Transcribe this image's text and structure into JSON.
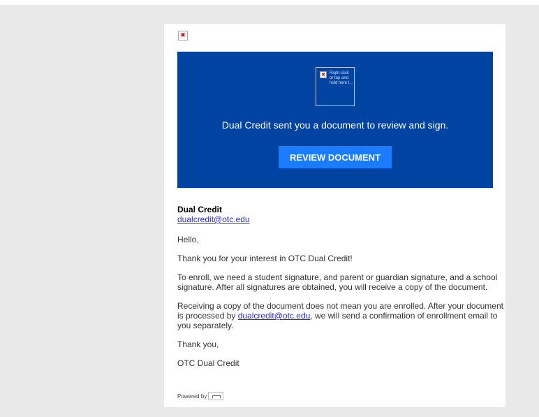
{
  "banner": {
    "broken_image_alt": "Right-click or tap and hold here t...",
    "message": "Dual Credit sent you a document to review and sign.",
    "button_label": "REVIEW DOCUMENT",
    "bg_color": "#0043a0",
    "button_color": "#1b7cff"
  },
  "sender": {
    "name": "Dual Credit",
    "email": "dualcredit@otc.edu"
  },
  "body": {
    "greeting": "Hello,",
    "para1": "Thank you for your interest in OTC Dual Credit!",
    "para2": "To enroll, we need a student signature, and parent or guardian signature, and a school signature. After all signatures are obtained, you will receive a copy of the document.",
    "para3_before": "Receiving a copy of the document does not mean you are enrolled. After your document is processed by ",
    "para3_link": "dualcredit@otc.edu",
    "para3_after": ", we will send a confirmation of enrollment email to you separately.",
    "closing": "Thank you,",
    "signature": "OTC Dual Credit"
  },
  "footer": {
    "powered_by": "Powered by"
  },
  "icons": {
    "broken_image": "broken-image-icon",
    "powered_logo": "docusign-logo-icon"
  }
}
